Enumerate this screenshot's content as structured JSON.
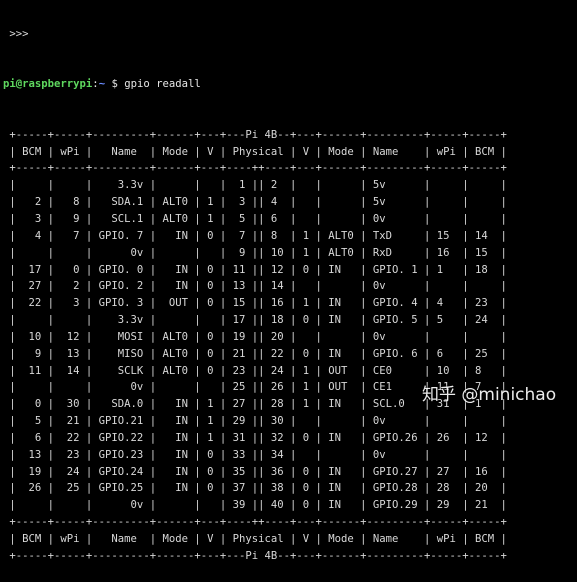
{
  "prompt": {
    "top_fragment": " >>>",
    "user_host": "pi@raspberrypi",
    "separator": ":",
    "path": "~",
    "sign": " $ ",
    "command": "gpio readall"
  },
  "table_lines": [
    " +-----+-----+---------+------+---+---Pi 4B--+---+------+---------+-----+-----+",
    " | BCM | wPi |   Name  | Mode | V | Physical | V | Mode | Name    | wPi | BCM |",
    " +-----+-----+---------+------+---+----++----+---+------+---------+-----+-----+",
    " |     |     |    3.3v |      |   |  1 || 2  |   |      | 5v      |     |     |",
    " |   2 |   8 |   SDA.1 | ALT0 | 1 |  3 || 4  |   |      | 5v      |     |     |",
    " |   3 |   9 |   SCL.1 | ALT0 | 1 |  5 || 6  |   |      | 0v      |     |     |",
    " |   4 |   7 | GPIO. 7 |   IN | 0 |  7 || 8  | 1 | ALT0 | TxD     | 15  | 14  |",
    " |     |     |      0v |      |   |  9 || 10 | 1 | ALT0 | RxD     | 16  | 15  |",
    " |  17 |   0 | GPIO. 0 |   IN | 0 | 11 || 12 | 0 | IN   | GPIO. 1 | 1   | 18  |",
    " |  27 |   2 | GPIO. 2 |   IN | 0 | 13 || 14 |   |      | 0v      |     |     |",
    " |  22 |   3 | GPIO. 3 |  OUT | 0 | 15 || 16 | 1 | IN   | GPIO. 4 | 4   | 23  |",
    " |     |     |    3.3v |      |   | 17 || 18 | 0 | IN   | GPIO. 5 | 5   | 24  |",
    " |  10 |  12 |    MOSI | ALT0 | 0 | 19 || 20 |   |      | 0v      |     |     |",
    " |   9 |  13 |    MISO | ALT0 | 0 | 21 || 22 | 0 | IN   | GPIO. 6 | 6   | 25  |",
    " |  11 |  14 |    SCLK | ALT0 | 0 | 23 || 24 | 1 | OUT  | CE0     | 10  | 8   |",
    " |     |     |      0v |      |   | 25 || 26 | 1 | OUT  | CE1     | 11  | 7   |",
    " |   0 |  30 |   SDA.0 |   IN | 1 | 27 || 28 | 1 | IN   | SCL.0   | 31  | 1   |",
    " |   5 |  21 | GPIO.21 |   IN | 1 | 29 || 30 |   |      | 0v      |     |     |",
    " |   6 |  22 | GPIO.22 |   IN | 1 | 31 || 32 | 0 | IN   | GPIO.26 | 26  | 12  |",
    " |  13 |  23 | GPIO.23 |   IN | 0 | 33 || 34 |   |      | 0v      |     |     |",
    " |  19 |  24 | GPIO.24 |   IN | 0 | 35 || 36 | 0 | IN   | GPIO.27 | 27  | 16  |",
    " |  26 |  25 | GPIO.25 |   IN | 0 | 37 || 38 | 0 | IN   | GPIO.28 | 28  | 20  |",
    " |     |     |      0v |      |   | 39 || 40 | 0 | IN   | GPIO.29 | 29  | 21  |",
    " +-----+-----+---------+------+---+----++----+---+------+---------+-----+-----+",
    " | BCM | wPi |   Name  | Mode | V | Physical | V | Mode | Name    | wPi | BCM |",
    " +-----+-----+---------+------+---+---Pi 4B--+---+------+---------+-----+-----+"
  ],
  "watermark": "知乎 @minichao"
}
